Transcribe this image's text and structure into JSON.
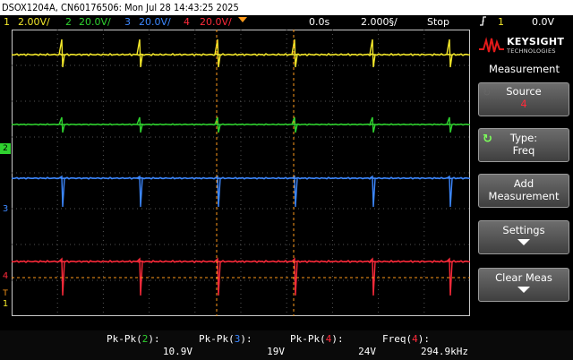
{
  "title": "DSOX1204A, CN60176506: Mon Jul 28 14:43:25 2025",
  "channels": [
    {
      "num": "1",
      "scale": "2.00V/",
      "color": "#f2e72a"
    },
    {
      "num": "2",
      "scale": "20.0V/",
      "color": "#2fd12f"
    },
    {
      "num": "3",
      "scale": "20.0V/",
      "color": "#3d88ff"
    },
    {
      "num": "4",
      "scale": "20.0V/",
      "color": "#ff2a3a"
    }
  ],
  "timebase": {
    "delay": "0.0s",
    "scale": "2.000§/",
    "status": "Stop"
  },
  "trigger": {
    "icon": "rising-edge-icon",
    "source": "1",
    "level": "0.0V"
  },
  "brand": {
    "name": "KEYSIGHT",
    "sub": "TECHNOLOGIES"
  },
  "menu": {
    "title": "Measurement",
    "source_label": "Source",
    "source_value": "4",
    "type_label": "Type:",
    "type_value": "Freq",
    "add_label_1": "Add",
    "add_label_2": "Measurement",
    "settings_label": "Settings",
    "clear_label": "Clear Meas"
  },
  "measurements": [
    {
      "name": "Pk-Pk(",
      "ch": "2",
      "close": "):",
      "value": "10.9V"
    },
    {
      "name": "Pk-Pk(",
      "ch": "3",
      "close": "):",
      "value": "19V"
    },
    {
      "name": "Pk-Pk(",
      "ch": "4",
      "close": "):",
      "value": "24V"
    },
    {
      "name": "Freq(",
      "ch": "4",
      "close": "):",
      "value": "294.9kHz"
    }
  ],
  "markers": {
    "ch2": "2",
    "ch3": "3",
    "ch4": "4",
    "t": "T",
    "ch1": "1"
  }
}
